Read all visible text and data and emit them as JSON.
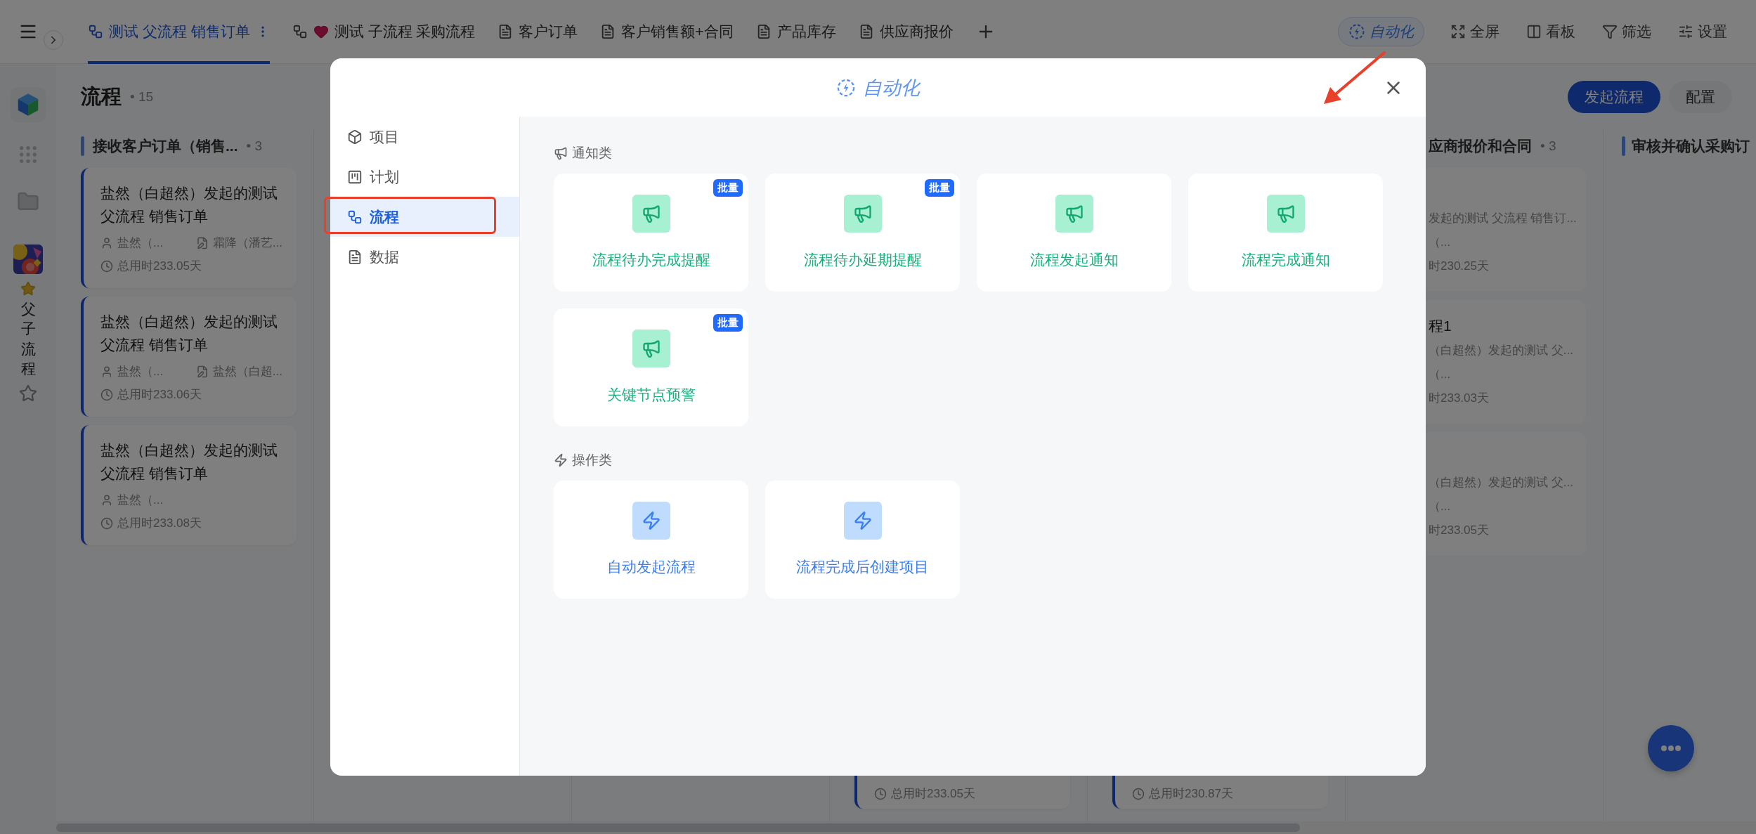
{
  "top_bar": {
    "tabs": [
      {
        "label": "测试 父流程 销售订单",
        "selected": true
      },
      {
        "label": "测试 子流程 采购流程",
        "selected": false
      },
      {
        "label": "客户订单",
        "selected": false
      },
      {
        "label": "客户销售额+合同",
        "selected": false
      },
      {
        "label": "产品库存",
        "selected": false
      },
      {
        "label": "供应商报价",
        "selected": false
      }
    ],
    "tools": [
      {
        "label": "自动化",
        "kind": "automation",
        "highlighted": true
      },
      {
        "label": "全屏",
        "kind": "fullscreen",
        "highlighted": false
      },
      {
        "label": "看板",
        "kind": "board",
        "highlighted": false
      },
      {
        "label": "筛选",
        "kind": "filter",
        "highlighted": false
      },
      {
        "label": "设置",
        "kind": "settings",
        "highlighted": false
      }
    ]
  },
  "rail": {
    "app_name": "父子流程"
  },
  "page": {
    "title": "流程",
    "count": "• 15",
    "buttons": [
      {
        "label": "发起流程",
        "kind": "primary"
      },
      {
        "label": "配置",
        "kind": "secondary"
      }
    ]
  },
  "columns": [
    {
      "kind": "full",
      "title": "接收客户订单（销售...",
      "count": "• 3",
      "cards": [
        {
          "title": "盐然（白超然）发起的测试父流程 销售订单",
          "owner": "盐然（...",
          "handler": "霜降（潘艺...",
          "duration": "总用时233.05天"
        },
        {
          "title": "盐然（白超然）发起的测试父流程 销售订单",
          "owner": "盐然（...",
          "handler": "盐然（白超...",
          "duration": "总用时233.06天"
        },
        {
          "title": "盐然（白超然）发起的测试父流程 销售订单",
          "owner": "盐然（...",
          "duration": "总用时233.08天"
        }
      ]
    },
    {
      "kind": "blank"
    },
    {
      "kind": "blank"
    },
    {
      "kind": "tail",
      "cards": [
        {
          "duration": "总用时233.05天"
        }
      ]
    },
    {
      "kind": "tail",
      "cards": [
        {
          "duration": "总用时230.87天"
        }
      ]
    },
    {
      "kind": "clipped",
      "title": "应商报价和合同",
      "count": "• 3",
      "cards": [
        {
          "lines": [
            "发起的测试 父流程 销售订...",
            "（...",
            "时230.25天"
          ]
        },
        {
          "title": "程1",
          "lines": [
            "（白超然）发起的测试 父...",
            "（...",
            "时233.03天"
          ]
        },
        {
          "lines": [
            "（白超然）发起的测试 父...",
            "（...",
            "时233.05天"
          ]
        }
      ]
    },
    {
      "kind": "edge",
      "title": "审核并确认采购订"
    }
  ],
  "modal": {
    "title": "自动化",
    "menu": [
      {
        "label": "项目",
        "selected": false
      },
      {
        "label": "计划",
        "selected": false
      },
      {
        "label": "流程",
        "selected": true
      },
      {
        "label": "数据",
        "selected": false
      }
    ],
    "sections": [
      {
        "title": "通知类",
        "kind": "notify",
        "items": [
          {
            "label": "流程待办完成提醒",
            "badge": "批量"
          },
          {
            "label": "流程待办延期提醒",
            "badge": "批量"
          },
          {
            "label": "流程发起通知"
          },
          {
            "label": "流程完成通知"
          },
          {
            "label": "关键节点预警",
            "badge": "批量"
          }
        ]
      },
      {
        "title": "操作类",
        "kind": "action",
        "items": [
          {
            "label": "自动发起流程"
          },
          {
            "label": "流程完成后创建项目"
          }
        ]
      }
    ]
  }
}
